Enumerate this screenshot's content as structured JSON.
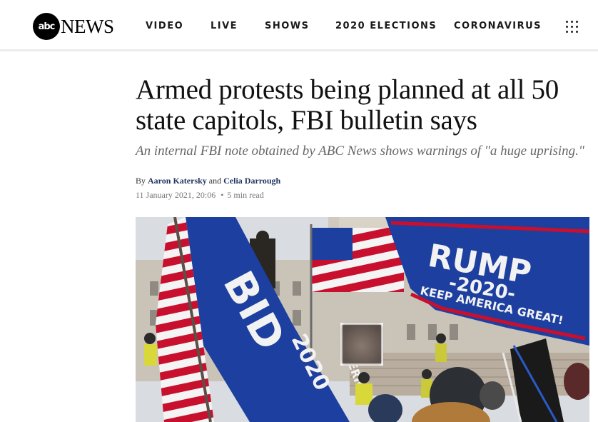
{
  "logo": {
    "circle_text": "abc",
    "text": "NEWS"
  },
  "nav": {
    "items": [
      "VIDEO",
      "LIVE",
      "SHOWS",
      "2020 ELECTIONS",
      "CORONAVIRUS"
    ],
    "more_icon": "grid-dots-icon"
  },
  "article": {
    "headline": "Armed protests being planned at all 50 state capitols, FBI bulletin says",
    "subhead": "An internal FBI note obtained by ABC News shows warnings of \"a huge uprising.\"",
    "byline": {
      "prefix": "By",
      "author1": "Aaron Katersky",
      "conjunction": "and",
      "author2": "Celia Darrough"
    },
    "date": "11 January 2021, 20:06",
    "separator": "•",
    "read_time": "5 min read"
  },
  "hero": {
    "flag_top_text": "RUMP",
    "flag_year_text": "-2020-",
    "flag_slogan_text": "KEEP AMERICA GREAT!",
    "left_flag_text": "BID",
    "lower_flag_text": "2020",
    "side_flag_text": "MERIC"
  },
  "colors": {
    "navy_link": "#23355e",
    "flag_blue": "#1c3fa0",
    "flag_red": "#c8102e"
  }
}
